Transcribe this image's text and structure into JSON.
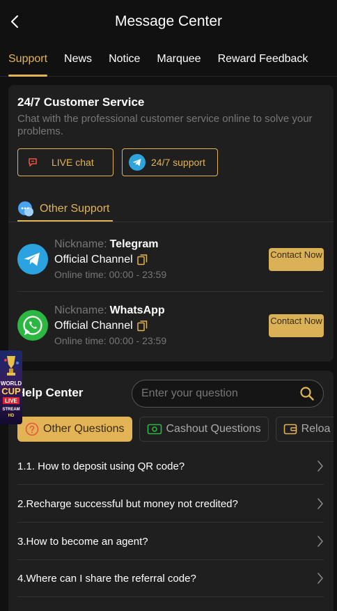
{
  "header": {
    "title": "Message Center"
  },
  "tabs": [
    {
      "label": "Support"
    },
    {
      "label": "News"
    },
    {
      "label": "Notice"
    },
    {
      "label": "Marquee"
    },
    {
      "label": "Reward Feedback"
    }
  ],
  "customer_service": {
    "title": "24/7 Customer Service",
    "description": "Chat with the professional customer service online to solve your problems.",
    "live_chat_label": "LIVE chat",
    "support_label": "24/7 support"
  },
  "other_support": {
    "tab_label": "Other Support",
    "contacts": [
      {
        "nickname_label": "Nickname:",
        "nickname": "Telegram",
        "channel": "Official Channel",
        "online_time_label": "Online time:",
        "online_time": "00:00 - 23:59",
        "button_label": "Contact Now",
        "icon": "telegram-icon"
      },
      {
        "nickname_label": "Nickname:",
        "nickname": "WhatsApp",
        "channel": "Official Channel",
        "online_time_label": "Online time:",
        "online_time": "00:00 - 23:59",
        "button_label": "Contact Now",
        "icon": "whatsapp-icon"
      }
    ]
  },
  "help_center": {
    "title": "Help Center",
    "search_placeholder": "Enter your question",
    "categories": [
      {
        "label": "Other Questions",
        "icon": "question-icon"
      },
      {
        "label": "Cashout Questions",
        "icon": "cash-icon"
      },
      {
        "label": "Reloa",
        "icon": "wallet-icon"
      }
    ],
    "faqs": [
      {
        "question": "1.1. How to deposit using QR code?"
      },
      {
        "question": "2.Recharge successful but money not credited?"
      },
      {
        "question": "3.How to become an agent?"
      },
      {
        "question": "4.Where can I share the referral code?"
      }
    ]
  },
  "promo": {
    "line1": "WORLD",
    "line2": "CUP",
    "line3": "LIVE",
    "line4": "STREAM",
    "line5": "HD"
  },
  "colors": {
    "accent": "#e3b456",
    "background": "#111111",
    "card": "#1f1f1f"
  }
}
